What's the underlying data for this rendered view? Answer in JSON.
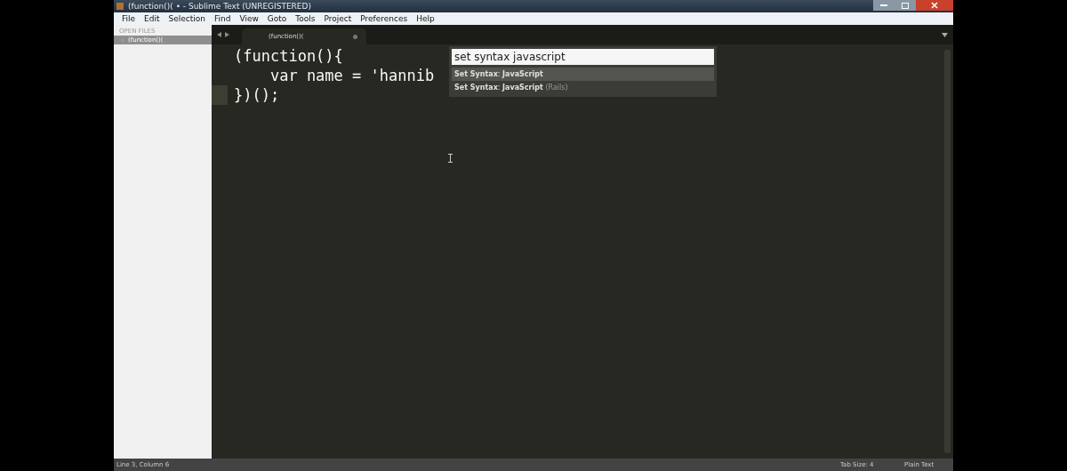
{
  "window": {
    "title": "(function()( • - Sublime Text (UNREGISTERED)"
  },
  "menu": [
    "File",
    "Edit",
    "Selection",
    "Find",
    "View",
    "Goto",
    "Tools",
    "Project",
    "Preferences",
    "Help"
  ],
  "sidebar": {
    "heading": "OPEN FILES",
    "files": [
      {
        "name": "(function()(",
        "selected": true
      }
    ]
  },
  "tabs": [
    {
      "label": "(function()(",
      "selected": true,
      "dirty": true
    }
  ],
  "editor": {
    "lines": [
      {
        "text": "(function(){",
        "current": false
      },
      {
        "text": "    var name = 'hannib",
        "current": false
      },
      {
        "text": "})();",
        "current": true
      }
    ]
  },
  "command_palette": {
    "value": "set syntax javascript",
    "items": [
      {
        "caption": "**Set Syntax**: **JavaScript**",
        "selected": true
      },
      {
        "caption": "**Set Syntax**: **JavaScript**",
        "hint": "(Rails)",
        "selected": false
      }
    ]
  },
  "status_bar": {
    "position": "Line 3, Column 6",
    "tab_size": "Tab Size: 4",
    "syntax": "Plain Text"
  }
}
